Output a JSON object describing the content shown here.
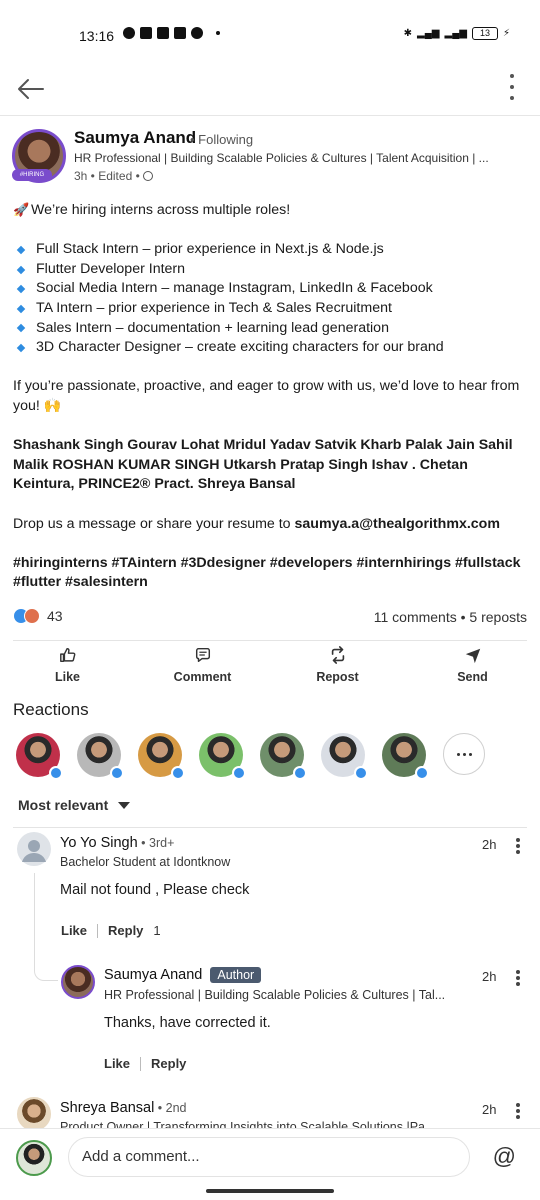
{
  "status_bar": {
    "time": "13:16",
    "battery": "13"
  },
  "post": {
    "author_name": "Saumya Anand",
    "following": "• Following",
    "headline": "HR Professional | Building Scalable Policies & Cultures | Talent Acquisition | ...",
    "hiring_badge": "#HIRING",
    "meta": "3h • Edited •",
    "intro": "We’re hiring interns across multiple roles!",
    "roles": [
      "Full Stack Intern – prior experience in Next.js & Node.js",
      "Flutter Developer Intern",
      "Social Media Intern – manage Instagram, LinkedIn & Facebook",
      "TA Intern – prior experience in Tech & Sales Recruitment",
      "Sales Intern – documentation + learning lead generation",
      "3D Character Designer – create exciting characters for our brand"
    ],
    "closing": "If you’re passionate, proactive, and eager to grow with us, we’d love to hear from you!",
    "closing_emoji": "🙌",
    "tags": "Shashank Singh Gourav Lohat Mridul Yadav Satvik Kharb Palak Jain Sahil Malik ROSHAN KUMAR SINGH Utkarsh Pratap Singh Ishav . Chetan Keintura, PRINCE2® Pract. Shreya Bansal",
    "drop_prefix": "Drop us a message or share your resume to ",
    "email": "saumya.a@thealgorithmx.com",
    "hashtags": "#hiringinterns #TAintern #3Ddesigner #developers #internhirings #fullstack #flutter #salesintern"
  },
  "social": {
    "reaction_count": "43",
    "comments_reposts": "11 comments • 5 reposts"
  },
  "actions": {
    "like": "Like",
    "comment": "Comment",
    "repost": "Repost",
    "send": "Send"
  },
  "reactions": {
    "title": "Reactions",
    "avatars": [
      {
        "name": "reactor-1",
        "color": "#c0304a"
      },
      {
        "name": "reactor-2",
        "color": "#b8b8b8"
      },
      {
        "name": "reactor-3",
        "color": "#d69a44"
      },
      {
        "name": "reactor-4",
        "color": "#7bc06a"
      },
      {
        "name": "reactor-5",
        "color": "#6f8f6a"
      },
      {
        "name": "reactor-6",
        "color": "#d9dde4"
      },
      {
        "name": "reactor-7",
        "color": "#5f7b58"
      }
    ]
  },
  "sort_label": "Most relevant",
  "comments": [
    {
      "name": "Yo Yo Singh",
      "degree": " • 3rd+",
      "headline": "Bachelor Student at Idontknow",
      "text": "Mail not found , Please check",
      "time": "2h",
      "like": "Like",
      "reply": "Reply",
      "reply_count": "1"
    },
    {
      "name": "Saumya Anand",
      "author_badge": "Author",
      "headline": "HR Professional | Building Scalable Policies & Cultures | Tal...",
      "text": "Thanks, have corrected it.",
      "time": "2h",
      "like": "Like",
      "reply": "Reply"
    },
    {
      "name": "Shreya Bansal",
      "degree": " • 2nd",
      "headline": "Product Owner | Transforming Insights into Scalable Solutions |Pa...",
      "time": "2h"
    }
  ],
  "composer": {
    "placeholder": "Add a comment..."
  }
}
